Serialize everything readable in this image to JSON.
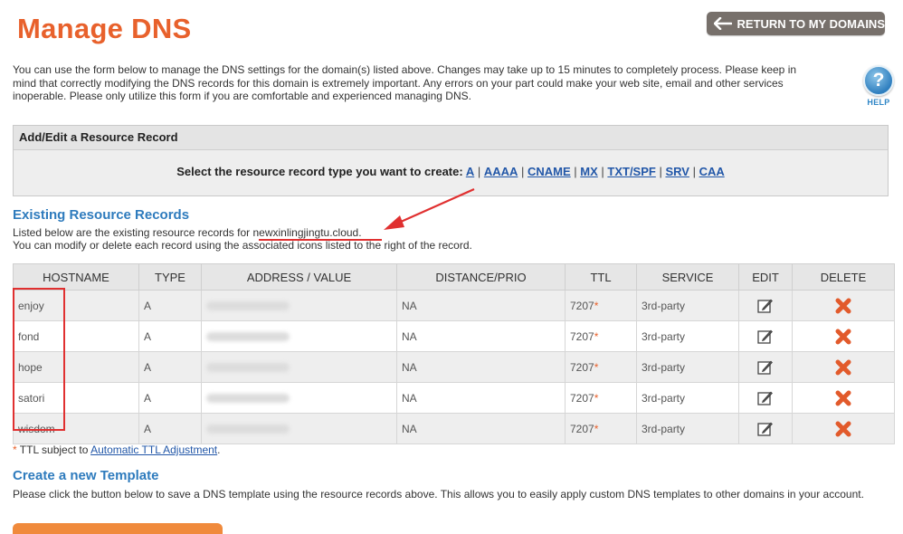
{
  "page_title": "Manage DNS",
  "return_button": {
    "label": "RETURN TO MY DOMAINS",
    "icon": "arrow-left-icon"
  },
  "intro": {
    "line1": "You can use the form below to manage the DNS settings for the domain(s) listed above. Changes may take up to 15 minutes to completely process. Please keep in",
    "line2": "mind that correctly modifying the DNS records for this domain is extremely important. Any errors on your part could make your web site, email and other services",
    "line3": "inoperable. Please only utilize this form if you are comfortable and experienced managing DNS."
  },
  "help": {
    "glyph": "?",
    "label": "HELP",
    "icon": "help-icon"
  },
  "add_edit": {
    "header": "Add/Edit a Resource Record",
    "prompt": "Select the resource record type you want to create:",
    "types": [
      "A",
      "AAAA",
      "CNAME",
      "MX",
      "TXT/SPF",
      "SRV",
      "CAA"
    ]
  },
  "existing": {
    "title": "Existing Resource Records",
    "listed_prefix": "Listed below are the existing resource records for",
    "domain": "newxinlingjingtu.cloud",
    "period": ".",
    "modify_text": "You can modify or delete each record using the associated icons listed to the right of the record."
  },
  "table": {
    "headers": [
      "HOSTNAME",
      "TYPE",
      "ADDRESS / VALUE",
      "DISTANCE/PRIO",
      "TTL",
      "SERVICE",
      "EDIT",
      "DELETE"
    ],
    "rows": [
      {
        "hostname": "enjoy",
        "type": "A",
        "distance": "NA",
        "ttl": "7207",
        "service": "3rd-party"
      },
      {
        "hostname": "fond",
        "type": "A",
        "distance": "NA",
        "ttl": "7207",
        "service": "3rd-party"
      },
      {
        "hostname": "hope",
        "type": "A",
        "distance": "NA",
        "ttl": "7207",
        "service": "3rd-party"
      },
      {
        "hostname": "satori",
        "type": "A",
        "distance": "NA",
        "ttl": "7207",
        "service": "3rd-party"
      },
      {
        "hostname": "wisdom",
        "type": "A",
        "distance": "NA",
        "ttl": "7207",
        "service": "3rd-party"
      }
    ],
    "ttl_star": "*",
    "edit_icon": "pencil-edit-icon",
    "delete_icon": "red-x-delete-icon"
  },
  "ttl_note": {
    "star": "*",
    "text": "TTL subject to",
    "link": "Automatic TTL Adjustment",
    "period": "."
  },
  "template": {
    "title": "Create a new Template",
    "text": "Please click the button below to save a DNS template using the resource records above. This allows you to easily apply custom DNS templates to other domains in your account."
  },
  "colors": {
    "title_orange": "#e8612c",
    "section_blue": "#2e7bbd",
    "link_blue": "#2257a8",
    "annotation_red": "#e03030",
    "button_gray": "#77706b"
  }
}
